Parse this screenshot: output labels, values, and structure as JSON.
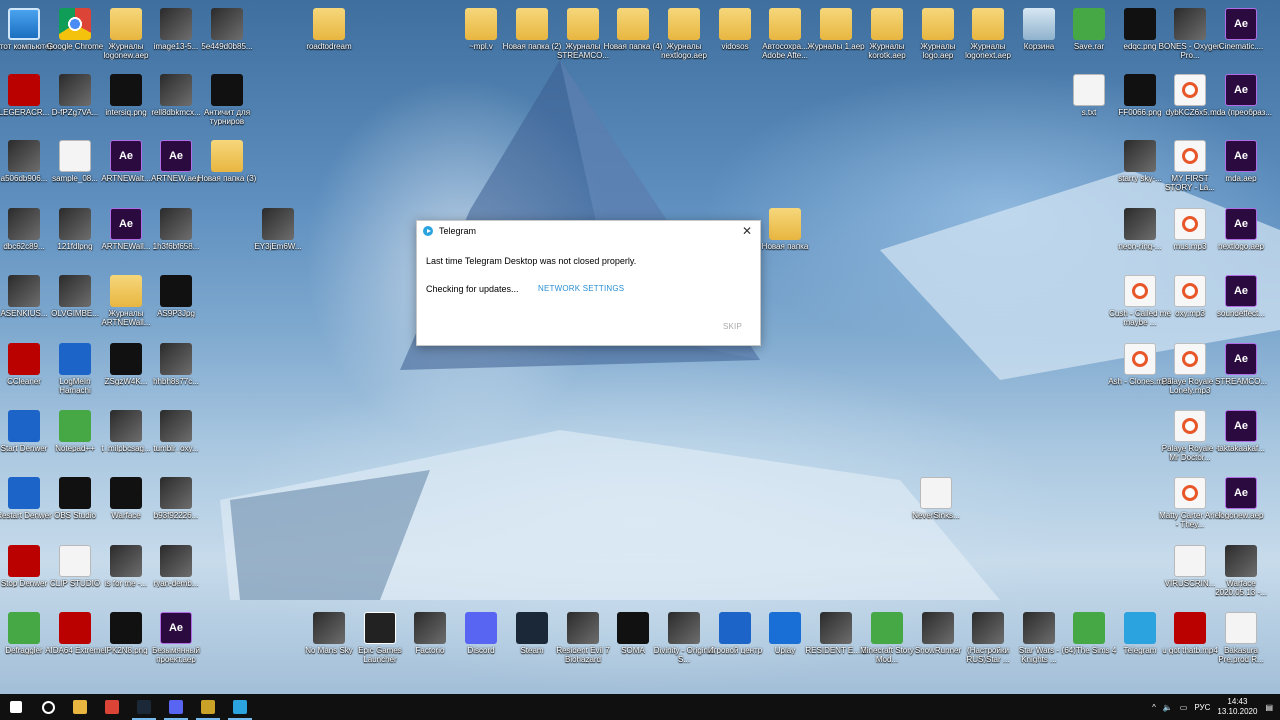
{
  "colors": {
    "accent": "#2aa3df",
    "taskbar": "#101010",
    "link": "#2a8fd6"
  },
  "desktop_icons": [
    {
      "label": "Этот компьютер",
      "icon": "computer-icon",
      "kind": "pc"
    },
    {
      "label": "Google Chrome",
      "icon": "chrome-icon",
      "kind": "chrome"
    },
    {
      "label": "Журналы logonew.aep",
      "icon": "folder-icon",
      "kind": "folder"
    },
    {
      "label": "image13-5...",
      "icon": "image-icon",
      "kind": "img"
    },
    {
      "label": "5e449d0b85...",
      "icon": "image-icon",
      "kind": "img"
    },
    {
      "label": "roadtodream",
      "icon": "folder-icon",
      "kind": "folder"
    },
    {
      "label": "~mpl.v",
      "icon": "folder-icon",
      "kind": "folder"
    },
    {
      "label": "Новая папка (2)",
      "icon": "folder-icon",
      "kind": "folder"
    },
    {
      "label": "Журналы STREAMCO...",
      "icon": "folder-icon",
      "kind": "folder"
    },
    {
      "label": "Новая папка (4)",
      "icon": "folder-icon",
      "kind": "folder"
    },
    {
      "label": "Журналы nextlogo.aep",
      "icon": "folder-icon",
      "kind": "folder"
    },
    {
      "label": "vidosos",
      "icon": "folder-icon",
      "kind": "folder"
    },
    {
      "label": "Автосохра... Adobe Afte...",
      "icon": "folder-icon",
      "kind": "folder"
    },
    {
      "label": "Журналы 1.aep",
      "icon": "folder-icon",
      "kind": "folder"
    },
    {
      "label": "Журналы korotk.aep",
      "icon": "folder-icon",
      "kind": "folder"
    },
    {
      "label": "Журналы logo.aep",
      "icon": "folder-icon",
      "kind": "folder"
    },
    {
      "label": "Журналы logonext.aep",
      "icon": "folder-icon",
      "kind": "folder"
    },
    {
      "label": "Корзина",
      "icon": "recycle-bin-icon",
      "kind": "recycle"
    },
    {
      "label": "Save.rar",
      "icon": "archive-icon",
      "kind": "green"
    },
    {
      "label": "edqc.png",
      "icon": "image-icon",
      "kind": "dark"
    },
    {
      "label": "BONES - Oxygen Pro...",
      "icon": "image-icon",
      "kind": "img"
    },
    {
      "label": "Cinematic....",
      "icon": "after-effects-icon",
      "kind": "ae"
    },
    {
      "label": "LEGERACR...",
      "icon": "image-icon",
      "kind": "red"
    },
    {
      "label": "D-fPZg7VA...",
      "icon": "image-icon",
      "kind": "img"
    },
    {
      "label": "intersiq.png",
      "icon": "image-icon",
      "kind": "dark"
    },
    {
      "label": "rell8dbkmcx...",
      "icon": "image-icon",
      "kind": "img"
    },
    {
      "label": "Античит для турниров",
      "icon": "shield-icon",
      "kind": "dark"
    },
    {
      "label": "s.txt",
      "icon": "text-file-icon",
      "kind": "file"
    },
    {
      "label": "FF0066.png",
      "icon": "image-icon",
      "kind": "dark"
    },
    {
      "label": "dybKCZ6x5...",
      "icon": "audio-icon",
      "kind": "audio"
    },
    {
      "label": "mda (преобраз...",
      "icon": "after-effects-icon",
      "kind": "ae"
    },
    {
      "label": "a506db906...",
      "icon": "image-icon",
      "kind": "img"
    },
    {
      "label": "sample_08...",
      "icon": "image-icon",
      "kind": "file"
    },
    {
      "label": "ARTNEWalt...",
      "icon": "after-effects-icon",
      "kind": "ae"
    },
    {
      "label": "ARTNEW.aep",
      "icon": "after-effects-icon",
      "kind": "ae"
    },
    {
      "label": "Новая папка (3)",
      "icon": "folder-icon",
      "kind": "folder"
    },
    {
      "label": "starry sky-...",
      "icon": "image-icon",
      "kind": "img"
    },
    {
      "label": "MY FIRST STORY - La...",
      "icon": "audio-icon",
      "kind": "audio"
    },
    {
      "label": "mda.aep",
      "icon": "after-effects-icon",
      "kind": "ae"
    },
    {
      "label": "dbc62c89...",
      "icon": "image-icon",
      "kind": "img"
    },
    {
      "label": "121fdlpng",
      "icon": "image-icon",
      "kind": "img"
    },
    {
      "label": "ARTNEWall...",
      "icon": "after-effects-icon",
      "kind": "ae"
    },
    {
      "label": "1h3f6bf658...",
      "icon": "image-icon",
      "kind": "img"
    },
    {
      "label": "EY3jEm6W...",
      "icon": "image-icon",
      "kind": "img"
    },
    {
      "label": "Новая папка",
      "icon": "folder-icon",
      "kind": "folder"
    },
    {
      "label": "neon-ring-...",
      "icon": "image-icon",
      "kind": "img"
    },
    {
      "label": "mus.mp3",
      "icon": "audio-icon",
      "kind": "audio"
    },
    {
      "label": "nextlogo.aep",
      "icon": "after-effects-icon",
      "kind": "ae"
    },
    {
      "label": "ASENKIUS...",
      "icon": "image-icon",
      "kind": "img"
    },
    {
      "label": "OLVGIMBE...",
      "icon": "image-icon",
      "kind": "img"
    },
    {
      "label": "Журналы ARTNEWall...",
      "icon": "folder-icon",
      "kind": "folder"
    },
    {
      "label": "AS9P3Jpg",
      "icon": "image-icon",
      "kind": "dark"
    },
    {
      "label": "Cush - Called me maybe ...",
      "icon": "audio-icon",
      "kind": "audio"
    },
    {
      "label": "oxy.mp3",
      "icon": "audio-icon",
      "kind": "audio"
    },
    {
      "label": "soundeffect...",
      "icon": "after-effects-icon",
      "kind": "ae"
    },
    {
      "label": "CCleaner",
      "icon": "ccleaner-icon",
      "kind": "red"
    },
    {
      "label": "LogMeIn Hamachi",
      "icon": "hamachi-icon",
      "kind": "blue"
    },
    {
      "label": "ZSgzW4K...",
      "icon": "image-icon",
      "kind": "dark"
    },
    {
      "label": "hhbh8s77c...",
      "icon": "image-icon",
      "kind": "img"
    },
    {
      "label": "Ash - Clones.mp3",
      "icon": "audio-icon",
      "kind": "audio"
    },
    {
      "label": "Palaye Royale - Lonely.mp3",
      "icon": "audio-icon",
      "kind": "audio"
    },
    {
      "label": "STREAMCO...",
      "icon": "after-effects-icon",
      "kind": "ae"
    },
    {
      "label": "Start Denwer",
      "icon": "denwer-icon",
      "kind": "blue"
    },
    {
      "label": "Notepad++",
      "icon": "notepad-icon",
      "kind": "green"
    },
    {
      "label": "t_milpbcsag...",
      "icon": "image-icon",
      "kind": "img"
    },
    {
      "label": "tumblr_oxy...",
      "icon": "image-icon",
      "kind": "img"
    },
    {
      "label": "Palaye Royale - Mr Doctor...",
      "icon": "audio-icon",
      "kind": "audio"
    },
    {
      "label": "taktakaakaf...",
      "icon": "after-effects-icon",
      "kind": "ae"
    },
    {
      "label": "Restart Denwer",
      "icon": "denwer-icon",
      "kind": "blue"
    },
    {
      "label": "OBS Studio",
      "icon": "obs-icon",
      "kind": "dark"
    },
    {
      "label": "Warface",
      "icon": "warface-icon",
      "kind": "dark"
    },
    {
      "label": "b93f92226...",
      "icon": "image-icon",
      "kind": "img"
    },
    {
      "label": "NeverSinks...",
      "icon": "text-file-icon",
      "kind": "file"
    },
    {
      "label": "Matty Carter Ariel - They...",
      "icon": "audio-icon",
      "kind": "audio"
    },
    {
      "label": "logonew.aep",
      "icon": "after-effects-icon",
      "kind": "ae"
    },
    {
      "label": "Stop Denwer",
      "icon": "denwer-icon",
      "kind": "red"
    },
    {
      "label": "CLIP STUDIO",
      "icon": "clip-studio-icon",
      "kind": "file"
    },
    {
      "label": "is for me -...",
      "icon": "image-icon",
      "kind": "img"
    },
    {
      "label": "ryan-demb...",
      "icon": "image-icon",
      "kind": "img"
    },
    {
      "label": "VIRUSCRIN...",
      "icon": "image-icon",
      "kind": "file"
    },
    {
      "label": "Warface 2020.05.13 -...",
      "icon": "image-icon",
      "kind": "img"
    },
    {
      "label": "Defraggler",
      "icon": "defraggler-icon",
      "kind": "green"
    },
    {
      "label": "AIDA64 Extreme",
      "icon": "aida64-icon",
      "kind": "red"
    },
    {
      "label": "IPK2N8.png",
      "icon": "image-icon",
      "kind": "dark"
    },
    {
      "label": "Безымянный проект.aep",
      "icon": "after-effects-icon",
      "kind": "ae"
    },
    {
      "label": "No Mans Sky",
      "icon": "game-icon",
      "kind": "img"
    },
    {
      "label": "Epic Games Launcher",
      "icon": "epic-icon",
      "kind": "epic"
    },
    {
      "label": "Factorio",
      "icon": "gear-icon",
      "kind": "img"
    },
    {
      "label": "Discord",
      "icon": "discord-icon",
      "kind": "discord"
    },
    {
      "label": "Steam",
      "icon": "steam-icon",
      "kind": "steam"
    },
    {
      "label": "Resident Evil 7 Biohazard",
      "icon": "game-icon",
      "kind": "img"
    },
    {
      "label": "SOMA",
      "icon": "game-icon",
      "kind": "dark"
    },
    {
      "label": "Divinity - Original S...",
      "icon": "game-icon",
      "kind": "img"
    },
    {
      "label": "Игровой центр",
      "icon": "game-center-icon",
      "kind": "blue"
    },
    {
      "label": "Uplay",
      "icon": "uplay-icon",
      "kind": "uplay"
    },
    {
      "label": "RESIDENT E... 3",
      "icon": "game-icon",
      "kind": "img"
    },
    {
      "label": "Minecraft Story Mod...",
      "icon": "game-icon",
      "kind": "green"
    },
    {
      "label": "SnowRunner",
      "icon": "game-icon",
      "kind": "img"
    },
    {
      "label": "(Настройки RUS)Star ...",
      "icon": "game-icon",
      "kind": "img"
    },
    {
      "label": "Star Wars - Knights ...",
      "icon": "game-icon",
      "kind": "img"
    },
    {
      "label": "(64)The Sims 4",
      "icon": "sims-icon",
      "kind": "green"
    },
    {
      "label": "Telegram",
      "icon": "telegram-icon",
      "kind": "tg"
    },
    {
      "label": "u got thatb.mp4",
      "icon": "video-icon",
      "kind": "red"
    },
    {
      "label": "Bakasura Pre.prod R...",
      "icon": "image-icon",
      "kind": "file"
    }
  ],
  "dialog": {
    "title": "Telegram",
    "close_glyph": "✕",
    "message": "Last time Telegram Desktop was not closed properly.",
    "status": "Checking for updates...",
    "network_button": "NETWORK SETTINGS",
    "skip_button": "SKIP"
  },
  "taskbar": {
    "items": [
      {
        "icon": "start-icon",
        "active": false
      },
      {
        "icon": "search-icon",
        "active": false
      },
      {
        "icon": "explorer-icon",
        "active": false
      },
      {
        "icon": "chrome-icon",
        "active": false
      },
      {
        "icon": "steam-icon",
        "active": true
      },
      {
        "icon": "discord-icon",
        "active": true
      },
      {
        "icon": "warface-icon",
        "active": true
      },
      {
        "icon": "telegram-icon",
        "active": true
      }
    ],
    "tray": {
      "lang": "РУС",
      "time": "14:43",
      "date": "13.10.2020"
    }
  }
}
